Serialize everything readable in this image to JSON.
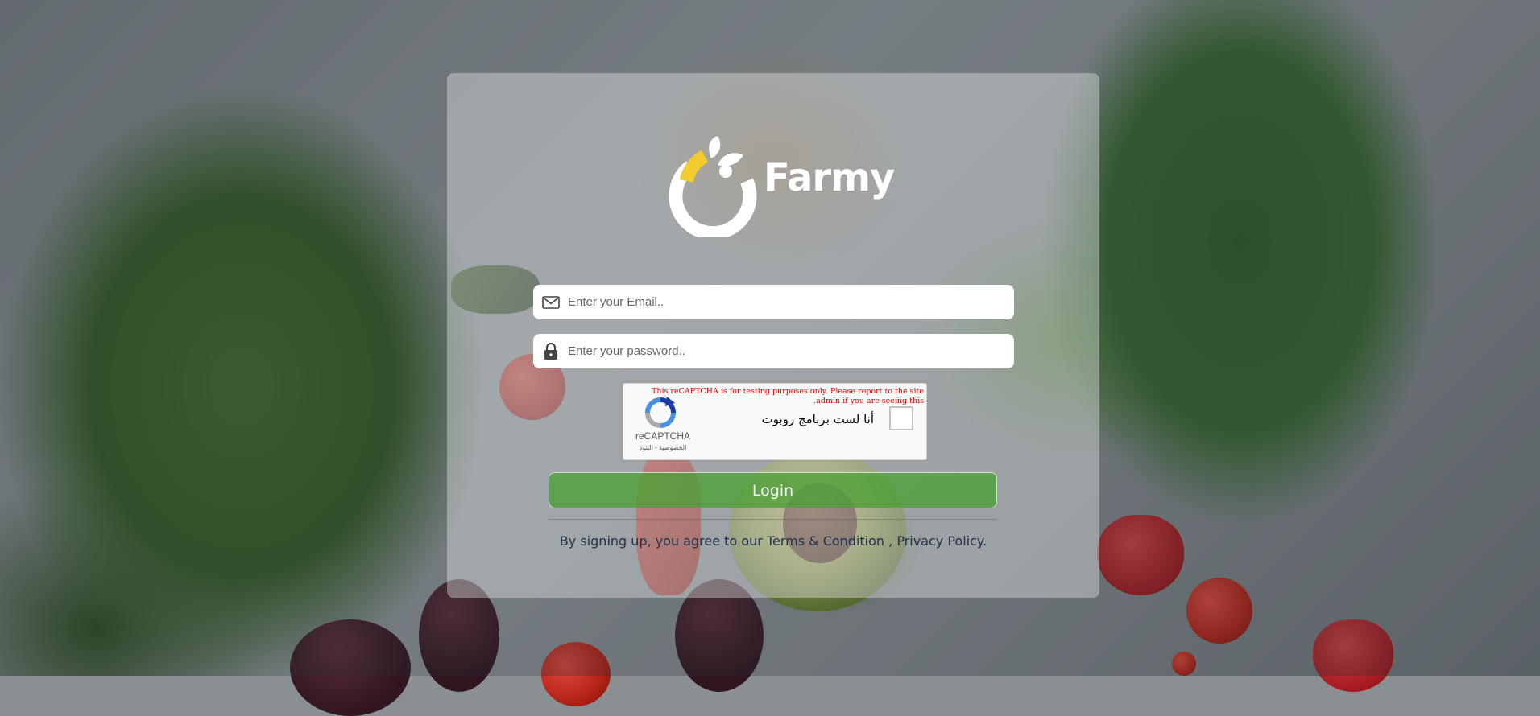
{
  "brand": {
    "name": "Farmy",
    "accent_color": "#f2cb2e",
    "logo_color": "#ffffff"
  },
  "login_form": {
    "email_placeholder": "Enter your Email..",
    "password_placeholder": "Enter your password..",
    "email_icon": "envelope-icon",
    "password_icon": "lock-icon",
    "login_label": "Login",
    "login_color": "#4ca034"
  },
  "recaptcha": {
    "warning": "This reCAPTCHA is for testing purposes only. Please report to the site admin if you are seeing this.",
    "checkbox_label": "أنا لست برنامج روبوت",
    "brand": "reCAPTCHA",
    "privacy": "الخصوصية",
    "separator": " - ",
    "terms": "البنود"
  },
  "footer": {
    "prefix": "By signing up, you agree to our ",
    "terms_link": "Terms & Condition",
    "separator": " , ",
    "privacy_link": "Privacy Policy."
  }
}
